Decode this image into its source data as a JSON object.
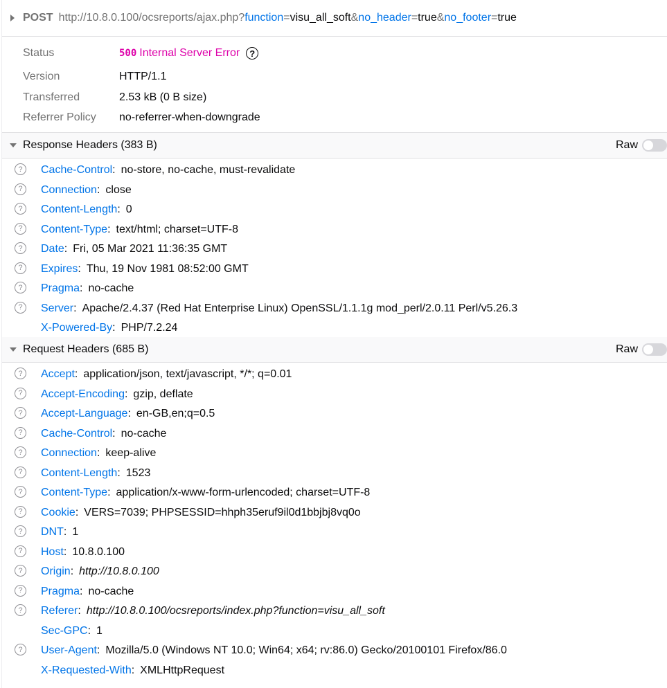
{
  "request": {
    "method": "POST",
    "url_base": "http://10.8.0.100/ocsreports/ajax.php?",
    "params": [
      {
        "key": "function",
        "value": "visu_all_soft",
        "sep": "&"
      },
      {
        "key": "no_header",
        "value": "true",
        "sep": "&"
      },
      {
        "key": "no_footer",
        "value": "true",
        "sep": ""
      }
    ]
  },
  "summary": {
    "status_label": "Status",
    "status_code": "500",
    "status_text": "Internal Server Error",
    "help_glyph": "?",
    "version_label": "Version",
    "version_value": "HTTP/1.1",
    "transferred_label": "Transferred",
    "transferred_value": "2.53 kB (0 B size)",
    "referrer_label": "Referrer Policy",
    "referrer_value": "no-referrer-when-downgrade"
  },
  "response_headers": {
    "title": "Response Headers (383 B)",
    "raw_label": "Raw",
    "raw_enabled": false,
    "items": [
      {
        "name": "Cache-Control",
        "value": "no-store, no-cache, must-revalidate",
        "help": true
      },
      {
        "name": "Connection",
        "value": "close",
        "help": true
      },
      {
        "name": "Content-Length",
        "value": "0",
        "help": true
      },
      {
        "name": "Content-Type",
        "value": "text/html; charset=UTF-8",
        "help": true
      },
      {
        "name": "Date",
        "value": "Fri, 05 Mar 2021 11:36:35 GMT",
        "help": true
      },
      {
        "name": "Expires",
        "value": "Thu, 19 Nov 1981 08:52:00 GMT",
        "help": true
      },
      {
        "name": "Pragma",
        "value": "no-cache",
        "help": true
      },
      {
        "name": "Server",
        "value": "Apache/2.4.37 (Red Hat Enterprise Linux) OpenSSL/1.1.1g mod_perl/2.0.11 Perl/v5.26.3",
        "help": true
      },
      {
        "name": "X-Powered-By",
        "value": "PHP/7.2.24",
        "help": false
      }
    ]
  },
  "request_headers": {
    "title": "Request Headers (685 B)",
    "raw_label": "Raw",
    "raw_enabled": false,
    "items": [
      {
        "name": "Accept",
        "value": "application/json, text/javascript, */*; q=0.01",
        "help": true
      },
      {
        "name": "Accept-Encoding",
        "value": "gzip, deflate",
        "help": true
      },
      {
        "name": "Accept-Language",
        "value": "en-GB,en;q=0.5",
        "help": true
      },
      {
        "name": "Cache-Control",
        "value": "no-cache",
        "help": true
      },
      {
        "name": "Connection",
        "value": "keep-alive",
        "help": true
      },
      {
        "name": "Content-Length",
        "value": "1523",
        "help": true
      },
      {
        "name": "Content-Type",
        "value": "application/x-www-form-urlencoded; charset=UTF-8",
        "help": true
      },
      {
        "name": "Cookie",
        "value": "VERS=7039; PHPSESSID=hhph35eruf9il0d1bbjbj8vq0o",
        "help": true
      },
      {
        "name": "DNT",
        "value": "1",
        "help": true
      },
      {
        "name": "Host",
        "value": "10.8.0.100",
        "help": true
      },
      {
        "name": "Origin",
        "value": "http://10.8.0.100",
        "help": true,
        "italic": true
      },
      {
        "name": "Pragma",
        "value": "no-cache",
        "help": true
      },
      {
        "name": "Referer",
        "value": "http://10.8.0.100/ocsreports/index.php?function=visu_all_soft",
        "help": true,
        "italic": true
      },
      {
        "name": "Sec-GPC",
        "value": "1",
        "help": false
      },
      {
        "name": "User-Agent",
        "value": "Mozilla/5.0 (Windows NT 10.0; Win64; x64; rv:86.0) Gecko/20100101 Firefox/86.0",
        "help": true
      },
      {
        "name": "X-Requested-With",
        "value": "XMLHttpRequest",
        "help": false
      }
    ]
  },
  "colors": {
    "header_name": "#0074e8",
    "status_error": "#dd00a9",
    "muted": "#737373"
  }
}
